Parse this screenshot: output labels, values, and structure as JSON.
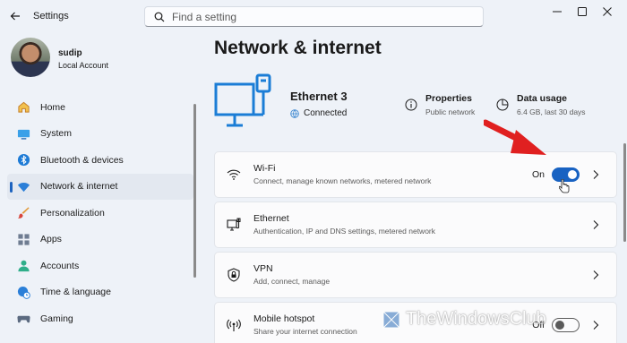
{
  "window": {
    "title": "Settings",
    "controls": [
      "minimize",
      "maximize",
      "close"
    ]
  },
  "search": {
    "placeholder": "Find a setting",
    "value": ""
  },
  "profile": {
    "name": "sudip",
    "account_type": "Local Account"
  },
  "sidebar": {
    "items": [
      {
        "label": "Home",
        "icon": "home-icon",
        "active": false
      },
      {
        "label": "System",
        "icon": "system-icon",
        "active": false
      },
      {
        "label": "Bluetooth & devices",
        "icon": "bluetooth-icon",
        "active": false
      },
      {
        "label": "Network & internet",
        "icon": "network-icon",
        "active": true
      },
      {
        "label": "Personalization",
        "icon": "brush-icon",
        "active": false
      },
      {
        "label": "Apps",
        "icon": "apps-icon",
        "active": false
      },
      {
        "label": "Accounts",
        "icon": "accounts-icon",
        "active": false
      },
      {
        "label": "Time & language",
        "icon": "globe-clock-icon",
        "active": false
      },
      {
        "label": "Gaming",
        "icon": "gamepad-icon",
        "active": false
      }
    ]
  },
  "main": {
    "title": "Network & internet",
    "connection": {
      "name": "Ethernet 3",
      "status": "Connected"
    },
    "properties": {
      "title": "Properties",
      "subtitle": "Public network"
    },
    "data_usage": {
      "title": "Data usage",
      "subtitle": "6.4 GB, last 30 days"
    },
    "cards": [
      {
        "title": "Wi-Fi",
        "subtitle": "Connect, manage known networks, metered network",
        "icon": "wifi-icon",
        "toggle": "On"
      },
      {
        "title": "Ethernet",
        "subtitle": "Authentication, IP and DNS settings, metered network",
        "icon": "ethernet-icon"
      },
      {
        "title": "VPN",
        "subtitle": "Add, connect, manage",
        "icon": "vpn-shield-icon"
      },
      {
        "title": "Mobile hotspot",
        "subtitle": "Share your internet connection",
        "icon": "hotspot-icon",
        "toggle": "Off"
      }
    ]
  },
  "watermark": {
    "text": "TheWindowsClub"
  },
  "colors": {
    "accent": "#1862c2",
    "arrow": "#e02020",
    "background": "#eef2f8"
  }
}
